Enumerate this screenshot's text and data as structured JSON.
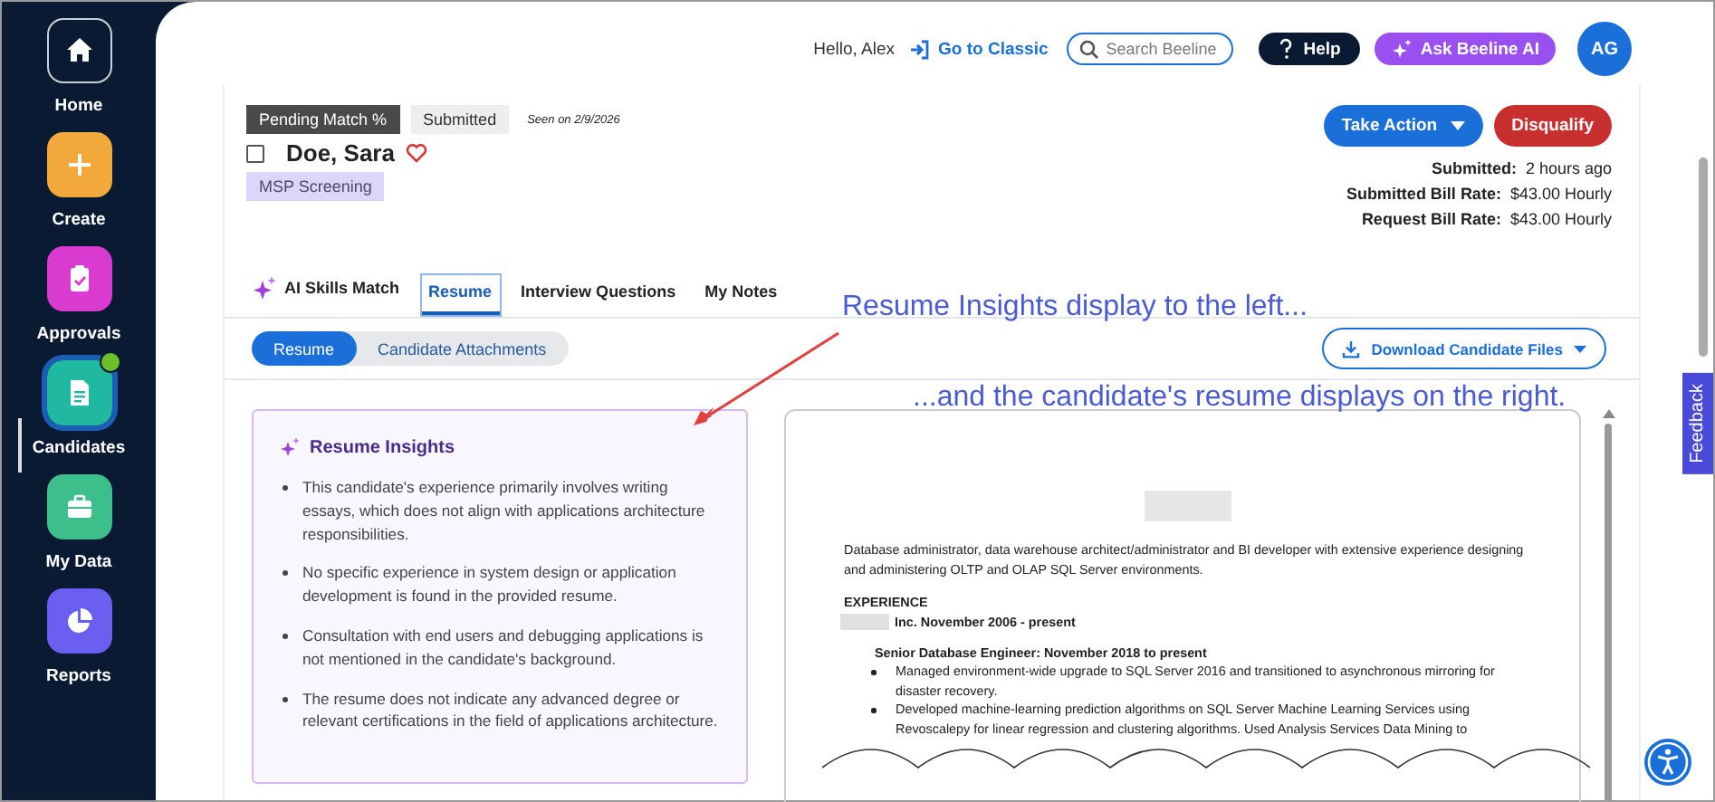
{
  "sidebar": {
    "items": [
      {
        "label": "Home",
        "kind": "home",
        "selected": false,
        "badge": false
      },
      {
        "label": "Create",
        "kind": "create",
        "selected": false,
        "badge": false
      },
      {
        "label": "Approvals",
        "kind": "approvals",
        "selected": false,
        "badge": false
      },
      {
        "label": "Candidates",
        "kind": "candidates",
        "selected": true,
        "badge": true
      },
      {
        "label": "My Data",
        "kind": "data",
        "selected": false,
        "badge": false
      },
      {
        "label": "Reports",
        "kind": "reports",
        "selected": false,
        "badge": false
      }
    ]
  },
  "topbar": {
    "greeting": "Hello, Alex",
    "classic_link": "Go to Classic",
    "search": {
      "placeholder": "Search Beeline"
    },
    "help": "Help",
    "ai_button": "Ask Beeline AI",
    "avatar": "AG"
  },
  "candidate": {
    "badges": [
      {
        "label": "Pending Match %",
        "kind": "dark"
      },
      {
        "label": "Submitted",
        "kind": "light"
      }
    ],
    "seen": "Seen on 2/9/2026",
    "checked": false,
    "name": "Doe, Sara",
    "favorite": false,
    "tag": "MSP Screening",
    "actions": [
      {
        "label": "Take Action",
        "kind": "menu"
      },
      {
        "label": "Disqualify",
        "kind": "danger"
      }
    ],
    "details": [
      {
        "label": "Submitted:",
        "value": "2 hours ago"
      },
      {
        "label": "Submitted Bill Rate:",
        "value": "$43.00 Hourly"
      },
      {
        "label": "Request Bill Rate:",
        "value": "$43.00 Hourly"
      }
    ]
  },
  "tabs": [
    {
      "label": "AI Skills Match",
      "selected": false,
      "kind": "ai"
    },
    {
      "label": "Resume",
      "selected": true,
      "kind": "plain"
    },
    {
      "label": "Interview Questions",
      "selected": false,
      "kind": "plain"
    },
    {
      "label": "My Notes",
      "selected": false,
      "kind": "plain"
    }
  ],
  "subtabs": [
    {
      "label": "Resume",
      "selected": true
    },
    {
      "label": "Candidate Attachments",
      "selected": false
    }
  ],
  "download_button": "Download Candidate Files",
  "insights": {
    "title": "Resume Insights",
    "items": [
      "This candidate's experience primarily involves writing essays, which does not align with applications architecture responsibilities.",
      "No specific experience in system design or application development is found in the provided resume.",
      "Consultation with end users and debugging applications is not mentioned in the candidate's background.",
      "The resume does not indicate any advanced degree or relevant certifications in the field of applications architecture."
    ]
  },
  "resume": {
    "summary": "Database administrator, data warehouse architect/administrator and BI developer with extensive experience designing and administering OLTP and OLAP SQL Server environments.",
    "section": "EXPERIENCE",
    "employer": "Inc.  November 2006  - present",
    "role": "Senior Database  Engineer: November 2018  to present",
    "bullets": [
      "Managed environment-wide upgrade to SQL Server 2016 and transitioned to asynchronous mirroring for disaster recovery.",
      "Developed machine-learning prediction algorithms on SQL Server Machine Learning Services using Revoscalepy for linear regression and clustering algorithms. Used Analysis Services Data Mining to"
    ]
  },
  "annotations": [
    "Resume Insights display to the left...",
    "...and the candidate's resume displays on the right."
  ],
  "feedback": "Feedback"
}
